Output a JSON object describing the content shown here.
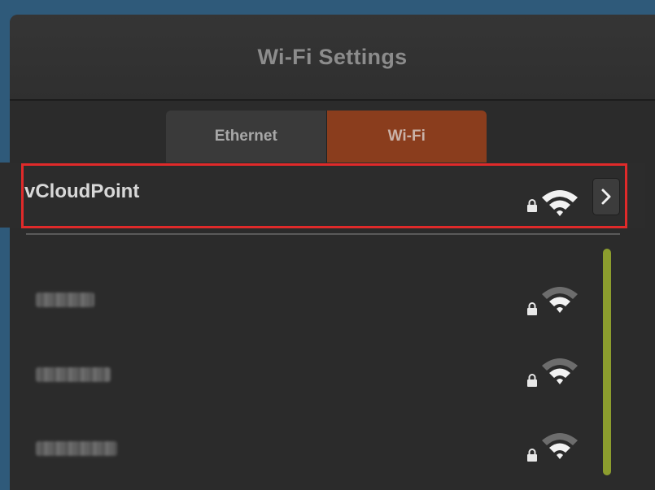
{
  "window": {
    "title": "Wi-Fi Settings"
  },
  "tabs": [
    {
      "label": "Ethernet",
      "active": false
    },
    {
      "label": "Wi-Fi",
      "active": true
    }
  ],
  "selected_network": {
    "name": "vCloudPoint",
    "locked": true,
    "signal": "full"
  },
  "networks": [
    {
      "name": "",
      "obscured": true,
      "locked": true,
      "signal": "strong"
    },
    {
      "name": "",
      "obscured": true,
      "locked": true,
      "signal": "strong"
    },
    {
      "name": "",
      "obscured": true,
      "locked": true,
      "signal": "strong"
    }
  ],
  "icons": {
    "lock": "lock-icon",
    "wifi": "wifi-signal-icon",
    "chevron": "chevron-right-icon"
  },
  "colors": {
    "active_tab": "#8a3d1d",
    "highlight_border": "#e02a2a",
    "scrollbar": "#8c9d2e"
  }
}
